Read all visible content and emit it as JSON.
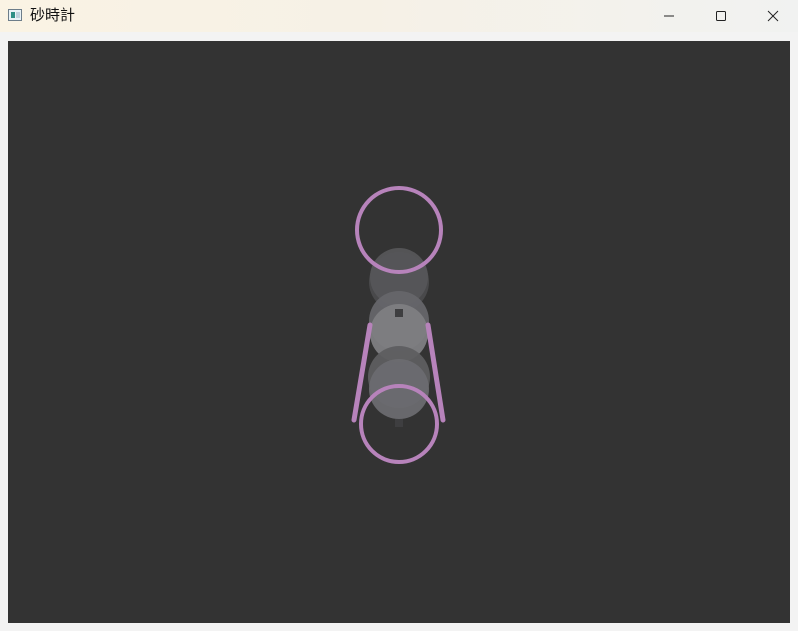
{
  "window": {
    "title": "砂時計",
    "app_icon": "app-window-icon",
    "controls": {
      "minimize_icon": "minimize-icon",
      "maximize_icon": "maximize-icon",
      "close_icon": "close-icon"
    }
  },
  "canvas": {
    "background_color": "#333333",
    "outline_color": "#b783bb",
    "ball_colors": [
      "#4b4b4d",
      "#5a5a5c",
      "#7e7e82",
      "#616163",
      "#6c6c70"
    ]
  }
}
